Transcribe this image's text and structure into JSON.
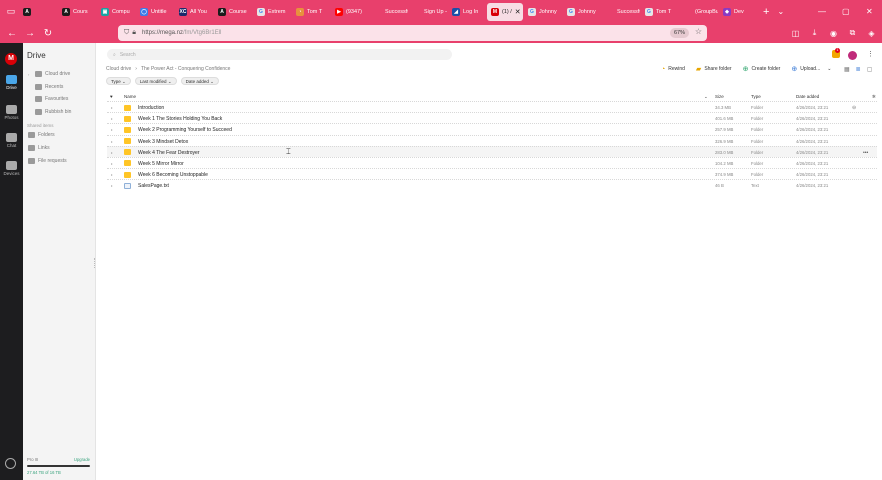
{
  "browser": {
    "tabs": [
      {
        "label": "",
        "color": "#1c1c1c",
        "glyph": "A"
      },
      {
        "label": "Cours",
        "color": "#1c1c1c",
        "glyph": "A"
      },
      {
        "label": "Compu",
        "color": "#1aa3a3",
        "glyph": "▣"
      },
      {
        "label": "Untitle",
        "color": "#3d7be8",
        "glyph": "◯"
      },
      {
        "label": "All You",
        "color": "#1b2a6b",
        "glyph": "XC"
      },
      {
        "label": "Course",
        "color": "#1c1c1c",
        "glyph": "A"
      },
      {
        "label": "Extrem",
        "color": "#e6e6e6",
        "glyph": "G"
      },
      {
        "label": "Tom T",
        "color": "#e8903d",
        "glyph": "◔"
      },
      {
        "label": "(9347)",
        "color": "#ff0000",
        "glyph": "▶"
      },
      {
        "label": "Successfulu",
        "color": "#e8406c",
        "glyph": ""
      },
      {
        "label": "Sign Up – S",
        "color": "#e8406c",
        "glyph": ""
      },
      {
        "label": "Log In",
        "color": "#1b4fa8",
        "glyph": "◢"
      },
      {
        "label": "(1) /",
        "color": "#d90007",
        "glyph": "M",
        "active": true
      },
      {
        "label": "Johnny",
        "color": "#e6e6e6",
        "glyph": "G"
      },
      {
        "label": "Johnny",
        "color": "#e6e6e6",
        "glyph": "G"
      },
      {
        "label": "Successfulu",
        "color": "#e8406c",
        "glyph": ""
      },
      {
        "label": "Tom T",
        "color": "#e6e6e6",
        "glyph": "G"
      },
      {
        "label": "(GroupBuy)",
        "color": "#e8406c",
        "glyph": ""
      },
      {
        "label": "Dev",
        "color": "#8a3ac2",
        "glyph": "◆"
      }
    ],
    "url_host": "https://mega.nz",
    "url_path": "/fm/Vtg6Br1Ell",
    "zoom": "67%"
  },
  "rail": {
    "logo": "M",
    "items": [
      {
        "label": "Drive",
        "active": true
      },
      {
        "label": "Photos"
      },
      {
        "label": "Chat"
      },
      {
        "label": "Devices"
      }
    ]
  },
  "sidebar": {
    "title": "Drive",
    "items": [
      {
        "label": "Cloud drive"
      },
      {
        "label": "Recents"
      },
      {
        "label": "Favourites"
      },
      {
        "label": "Rubbish bin"
      }
    ],
    "section_label": "Shared items",
    "shared": [
      {
        "label": "Folders"
      },
      {
        "label": "Links"
      },
      {
        "label": "File requests"
      }
    ],
    "storage": {
      "plan": "Pro III",
      "upgrade": "Upgrade",
      "used": "27.64 TB of 16 TB"
    }
  },
  "main": {
    "search_placeholder": "Search",
    "notif_count": "1",
    "breadcrumb": [
      "Cloud drive",
      "›",
      "The Power Act - Conquering Confidence"
    ],
    "filters": [
      "Type",
      "Last modified",
      "Date added"
    ],
    "actions": {
      "rewind": "Rewind",
      "share": "Share folder",
      "create": "Create folder",
      "upload": "Upload..."
    },
    "columns": {
      "name": "Name",
      "size": "Size",
      "type": "Type",
      "date": "Date added"
    },
    "rows": [
      {
        "name": "Introduction",
        "size": "34.3 MB",
        "type": "Folder",
        "date": "4/26/2024, 23:21",
        "kind": "folder",
        "link": true
      },
      {
        "name": "Week 1 The Stories Holding You Back",
        "size": "401.6 MB",
        "type": "Folder",
        "date": "4/26/2024, 23:21",
        "kind": "folder"
      },
      {
        "name": "Week 2 Programming Yourself to Succeed",
        "size": "257.9 MB",
        "type": "Folder",
        "date": "4/26/2024, 23:21",
        "kind": "folder"
      },
      {
        "name": "Week 3 Mindset Detox",
        "size": "326.9 MB",
        "type": "Folder",
        "date": "4/26/2024, 23:21",
        "kind": "folder"
      },
      {
        "name": "Week 4 The Fear Destroyer",
        "size": "283.0 MB",
        "type": "Folder",
        "date": "4/26/2024, 23:21",
        "kind": "folder",
        "hover": true
      },
      {
        "name": "Week 5 Mirror Mirror",
        "size": "104.2 MB",
        "type": "Folder",
        "date": "4/26/2024, 23:21",
        "kind": "folder"
      },
      {
        "name": "Week 6 Becoming Unstoppable",
        "size": "374.9 MB",
        "type": "Folder",
        "date": "4/26/2024, 23:21",
        "kind": "folder"
      },
      {
        "name": "SalesPage.txt",
        "size": "46 B",
        "type": "Text",
        "date": "4/26/2024, 23:21",
        "kind": "text"
      }
    ]
  }
}
